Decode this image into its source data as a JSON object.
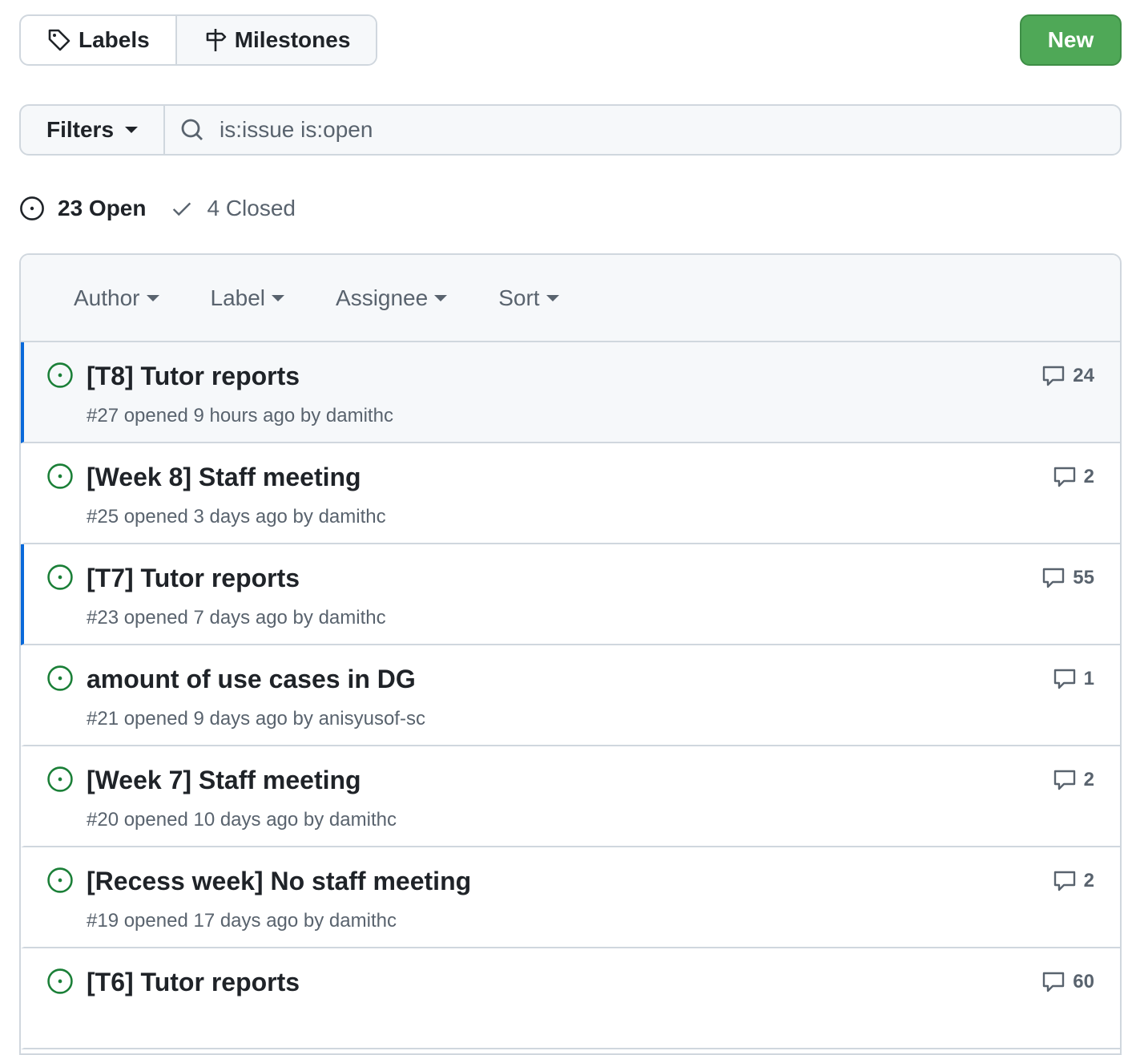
{
  "nav": {
    "labels": "Labels",
    "milestones": "Milestones",
    "new": "New"
  },
  "search": {
    "filters": "Filters",
    "query": "is:issue is:open"
  },
  "states": {
    "open": "23 Open",
    "closed": "4 Closed"
  },
  "filters": [
    "Author",
    "Label",
    "Assignee",
    "Sort"
  ],
  "colors": {
    "open": "#1a7f37",
    "accent": "#0969da",
    "new_button": "#4fa857"
  },
  "issues": [
    {
      "title": "[T8] Tutor reports",
      "meta": "#27 opened 9 hours ago by damithc",
      "comments": "24"
    },
    {
      "title": "[Week 8] Staff meeting",
      "meta": "#25 opened 3 days ago by damithc",
      "comments": "2"
    },
    {
      "title": "[T7] Tutor reports",
      "meta": "#23 opened 7 days ago by damithc",
      "comments": "55"
    },
    {
      "title": "amount of use cases in DG",
      "meta": "#21 opened 9 days ago by anisyusof-sc",
      "comments": "1"
    },
    {
      "title": "[Week 7] Staff meeting",
      "meta": "#20 opened 10 days ago by damithc",
      "comments": "2"
    },
    {
      "title": "[Recess week] No staff meeting",
      "meta": "#19 opened 17 days ago by damithc",
      "comments": "2"
    },
    {
      "title": "[T6] Tutor reports",
      "meta": "",
      "comments": "60"
    }
  ]
}
